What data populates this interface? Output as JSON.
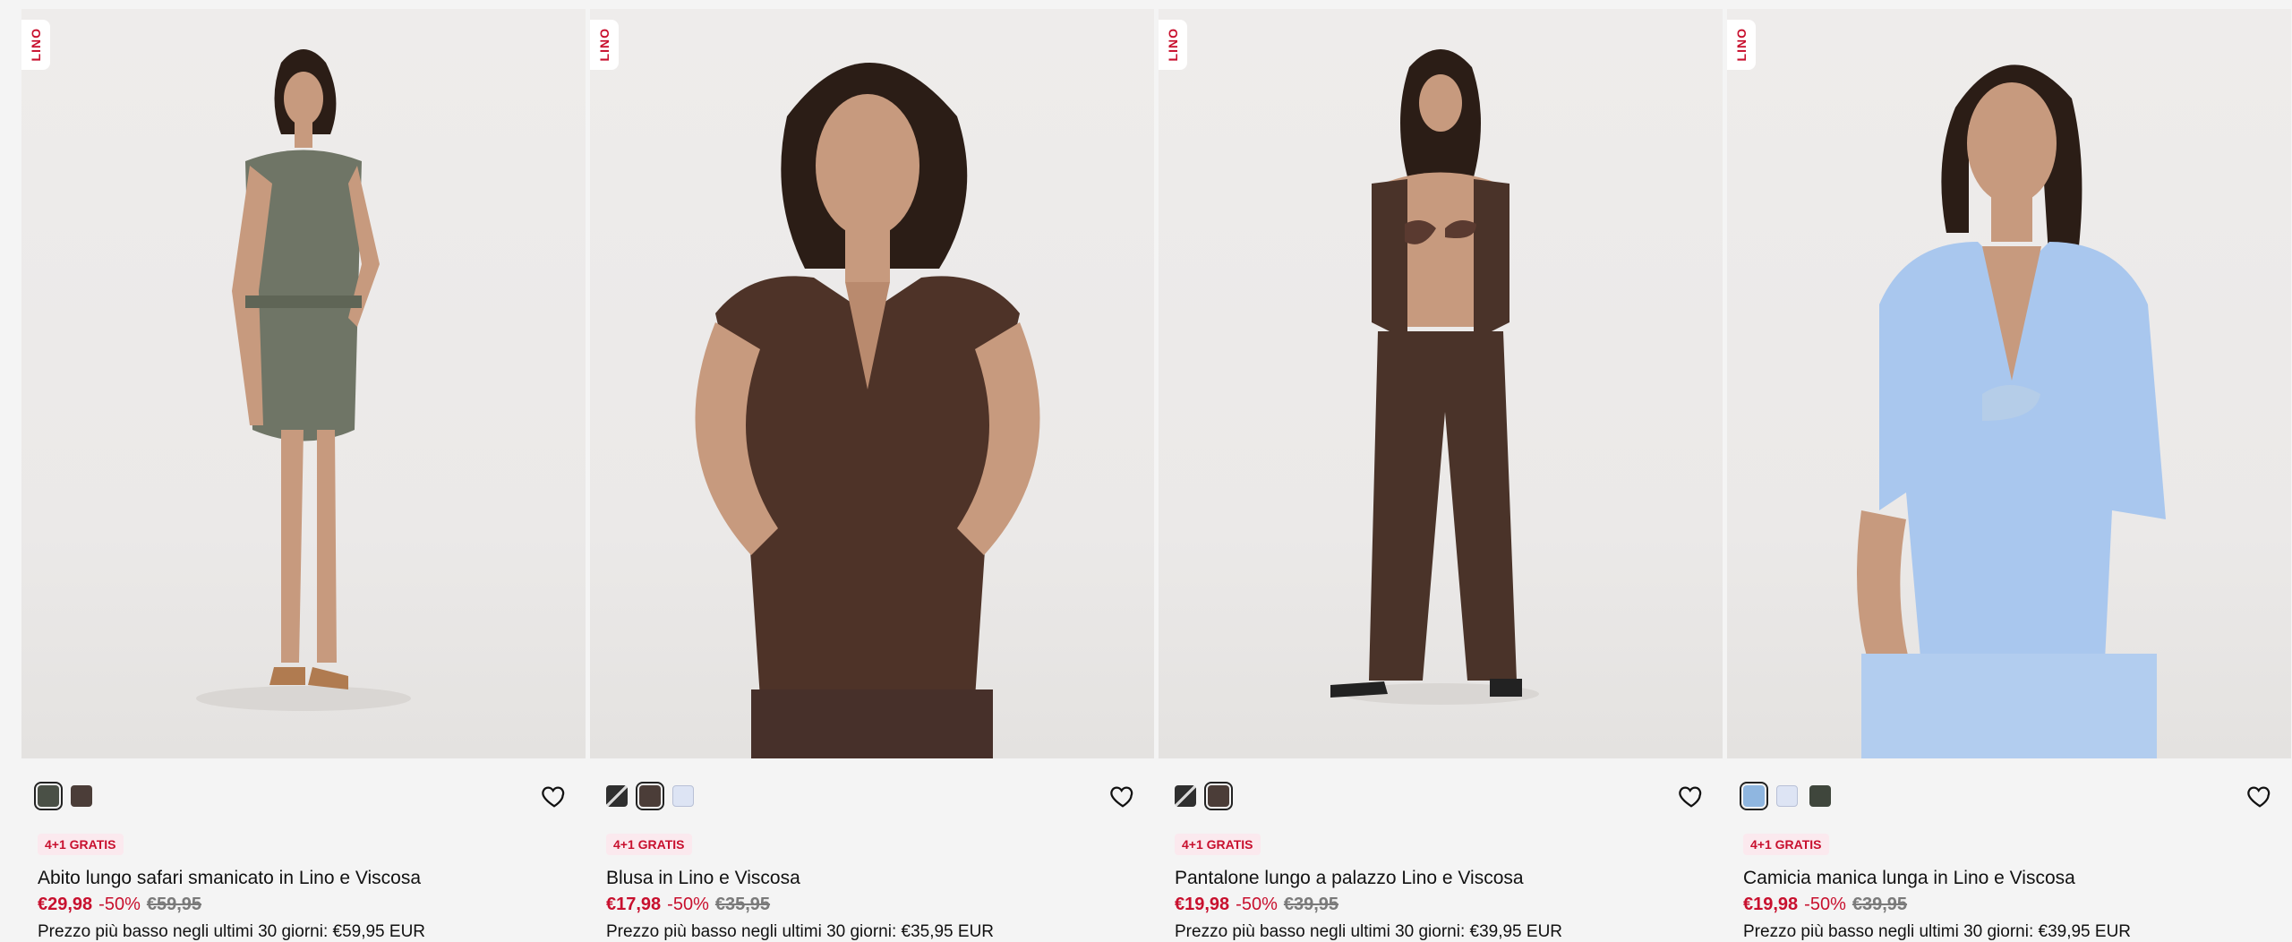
{
  "products": [
    {
      "tag": "LINO",
      "swatches": [
        {
          "color": "#4a5046",
          "selected": true,
          "pattern": false
        },
        {
          "color": "#4b3d38",
          "selected": false,
          "pattern": false
        }
      ],
      "badge": "4+1 GRATIS",
      "name": "Abito lungo safari smanicato in Lino e Viscosa",
      "price": "€29,98",
      "discount": "-50%",
      "old_price": "€59,95",
      "lowest_price": "Prezzo più basso negli ultimi 30 giorni: €59,95 EUR",
      "garment_color": "#6f7566"
    },
    {
      "tag": "LINO",
      "swatches": [
        {
          "color": "#2f2f2f",
          "selected": false,
          "pattern": true
        },
        {
          "color": "#4b3d38",
          "selected": true,
          "pattern": false
        },
        {
          "color": "#dde4f4",
          "selected": false,
          "pattern": false
        }
      ],
      "badge": "4+1 GRATIS",
      "name": "Blusa in Lino e Viscosa",
      "price": "€17,98",
      "discount": "-50%",
      "old_price": "€35,95",
      "lowest_price": "Prezzo più basso negli ultimi 30 giorni: €35,95 EUR",
      "garment_color": "#4e3328"
    },
    {
      "tag": "LINO",
      "swatches": [
        {
          "color": "#2f2f2f",
          "selected": false,
          "pattern": true
        },
        {
          "color": "#4b3d38",
          "selected": true,
          "pattern": false
        }
      ],
      "badge": "4+1 GRATIS",
      "name": "Pantalone lungo a palazzo Lino e Viscosa",
      "price": "€19,98",
      "discount": "-50%",
      "old_price": "€39,95",
      "lowest_price": "Prezzo più basso negli ultimi 30 giorni: €39,95 EUR",
      "garment_color": "#4a3329"
    },
    {
      "tag": "LINO",
      "swatches": [
        {
          "color": "#8fb6e0",
          "selected": true,
          "pattern": false
        },
        {
          "color": "#dde4f4",
          "selected": false,
          "pattern": false
        },
        {
          "color": "#3f463c",
          "selected": false,
          "pattern": false
        }
      ],
      "badge": "4+1 GRATIS",
      "name": "Camicia manica lunga in Lino e Viscosa",
      "price": "€19,98",
      "discount": "-50%",
      "old_price": "€39,95",
      "lowest_price": "Prezzo più basso negli ultimi 30 giorni: €39,95 EUR",
      "garment_color": "#a9c7ee"
    }
  ],
  "colors": {
    "accent": "#c8102e",
    "badge_bg": "#fbe9ee",
    "skin": "#c79a7e",
    "hair": "#2b1d16"
  },
  "icons": {
    "wishlist": "heart-outline-icon"
  }
}
